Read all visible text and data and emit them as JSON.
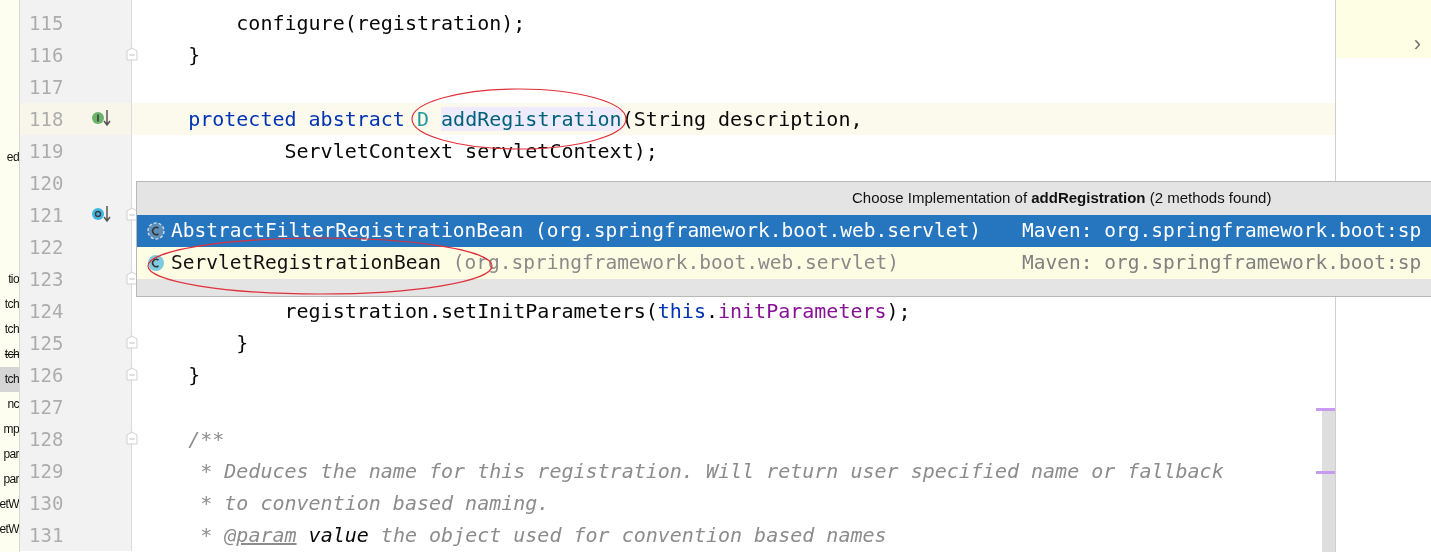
{
  "project_tree_fragment": [
    {
      "text": "ed",
      "selected": false,
      "strikethrough": false
    },
    {
      "text": "tio",
      "selected": false,
      "strikethrough": false
    },
    {
      "text": "tch",
      "selected": false,
      "strikethrough": false
    },
    {
      "text": "tch",
      "selected": false,
      "strikethrough": false
    },
    {
      "text": "tch",
      "selected": false,
      "strikethrough": true
    },
    {
      "text": "tch",
      "selected": true,
      "strikethrough": false
    },
    {
      "text": "nc",
      "selected": false,
      "strikethrough": false
    },
    {
      "text": "mp",
      "selected": false,
      "strikethrough": false
    },
    {
      "text": "par",
      "selected": false,
      "strikethrough": false
    },
    {
      "text": "par",
      "selected": false,
      "strikethrough": false
    },
    {
      "text": "etW",
      "selected": false,
      "strikethrough": false
    },
    {
      "text": "etW",
      "selected": false,
      "strikethrough": false
    }
  ],
  "editor": {
    "lines": [
      {
        "number": "115",
        "current": false,
        "foldable": false,
        "tokens": [
          {
            "kind": "plain",
            "text": "        configure(registration);"
          }
        ]
      },
      {
        "number": "116",
        "current": false,
        "foldable": true,
        "tokens": [
          {
            "kind": "plain",
            "text": "    }"
          }
        ]
      },
      {
        "number": "117",
        "current": false,
        "foldable": false
      },
      {
        "number": "118",
        "current": true,
        "foldable": false,
        "gutter_marker": {
          "kind": "implemented"
        },
        "tokens": [
          {
            "kind": "keyword",
            "text": "    protected abstract "
          },
          {
            "kind": "type_param",
            "text": "D "
          },
          {
            "kind": "method_match",
            "text": "addRegistration"
          },
          {
            "kind": "plain",
            "text": "(String description,"
          }
        ]
      },
      {
        "number": "119",
        "current": false,
        "foldable": false,
        "tokens": [
          {
            "kind": "plain",
            "text": "            ServletContext servletContext);"
          }
        ]
      },
      {
        "number": "120",
        "current": false,
        "foldable": false
      },
      {
        "number": "121",
        "current": false,
        "foldable": true,
        "gutter_marker": {
          "kind": "overrides"
        }
      },
      {
        "number": "122",
        "current": false,
        "foldable": false
      },
      {
        "number": "123",
        "current": false,
        "foldable": true
      },
      {
        "number": "124",
        "current": false,
        "foldable": false,
        "tokens": [
          {
            "kind": "plain",
            "text": "            registration.setInitParameters("
          },
          {
            "kind": "keyword",
            "text": "this"
          },
          {
            "kind": "plain",
            "text": "."
          },
          {
            "kind": "field",
            "text": "initParameters"
          },
          {
            "kind": "plain",
            "text": ");"
          }
        ]
      },
      {
        "number": "125",
        "current": false,
        "foldable": true,
        "tokens": [
          {
            "kind": "plain",
            "text": "        }"
          }
        ]
      },
      {
        "number": "126",
        "current": false,
        "foldable": true,
        "tokens": [
          {
            "kind": "plain",
            "text": "    }"
          }
        ]
      },
      {
        "number": "127",
        "current": false,
        "foldable": false
      },
      {
        "number": "128",
        "current": false,
        "foldable": true,
        "tokens": [
          {
            "kind": "comment",
            "text": "    /**"
          }
        ]
      },
      {
        "number": "129",
        "current": false,
        "foldable": false,
        "tokens": [
          {
            "kind": "comment",
            "text": "     * Deduces the name for this registration. Will return user specified name or fallback"
          }
        ]
      },
      {
        "number": "130",
        "current": false,
        "foldable": false,
        "tokens": [
          {
            "kind": "comment",
            "text": "     * to convention based naming."
          }
        ]
      },
      {
        "number": "131",
        "current": false,
        "foldable": false,
        "tokens": [
          {
            "kind": "comment",
            "text": "     * "
          },
          {
            "kind": "doc_tag",
            "text": "@param"
          },
          {
            "kind": "doc_param",
            "text": " value"
          },
          {
            "kind": "comment",
            "text": " the object used for convention based names"
          }
        ]
      }
    ]
  },
  "popup": {
    "title": "Choose Implementation of **addRegistration** (2 methods found)",
    "items": [
      {
        "selected": true,
        "name": "AbstractFilterRegistrationBean",
        "abstract": true,
        "package": "(org.springframework.boot.web.servlet)",
        "location": "Maven: org.springframework.boot:sp"
      },
      {
        "selected": false,
        "name": "ServletRegistrationBean",
        "abstract": false,
        "package": "(org.springframework.boot.web.servlet)",
        "location": "Maven: org.springframework.boot:sp"
      }
    ]
  },
  "right_panel": {
    "chevron": "›"
  }
}
